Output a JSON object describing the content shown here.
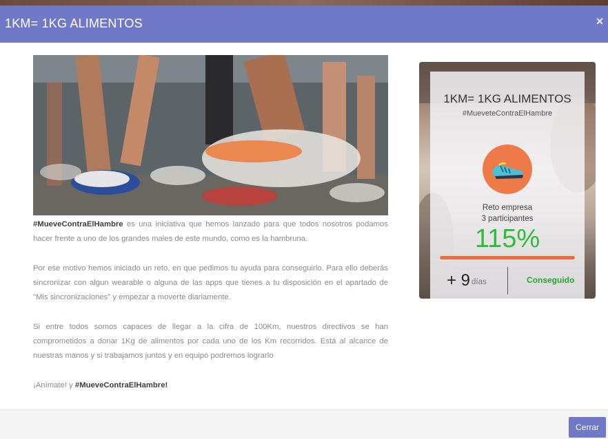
{
  "modal": {
    "title": "1KM= 1KG ALIMENTOS",
    "close_symbol": "×",
    "footer_button": "Cerrar"
  },
  "hero_image": {
    "description_icon": "running-shoes-photo"
  },
  "content": {
    "p1_hashtag": "#MueveContraElHambre",
    "p1_text": " es una iniciativa que hemos lanzado para que todos nosotros podamos hacer frente a uno de los grandes males de este mundo, como es la hambruna.",
    "p2": "Por ese motivo hemos iniciado un reto, en que pedimos tu ayuda para conseguirlo. Para ello deberás sincronizar con algun wearable o alguna de las apps que tienes a tu disposición en el apartado de \"Mis sincronizaciones\" y empezar a moverte diariamente.",
    "p3": "Si entre todos somos capaces de llegar a la cifra de 100Km, nuestros directivos se han comprometidos a donar 1Kg de alimentos por cada uno de los Km recorridos. Está al alcance de nuestras manos y si trabajamos juntos y en equipo podremos lograrlo",
    "p4_text": "¡Anímate! y ",
    "p4_hashtag": "#MueveContraElHambre!"
  },
  "card": {
    "title": "1KM= 1KG ALIMENTOS",
    "hashtag": "#MueveteContraElHambre",
    "icon": "running-shoe-icon",
    "type_label": "Reto empresa",
    "participants": "3 participantes",
    "percent": "115%",
    "progress": 1.0,
    "days_value": "+ 9",
    "days_label": "días",
    "status": "Conseguido"
  },
  "colors": {
    "header": "#7078c8",
    "accent_orange": "#ef6a3f",
    "success_green": "#2ebd3a"
  }
}
